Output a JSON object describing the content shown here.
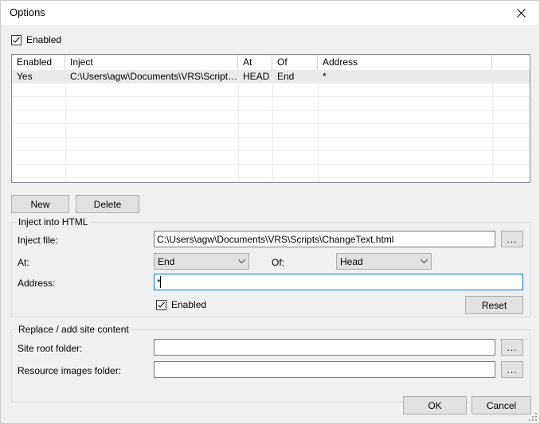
{
  "window": {
    "title": "Options",
    "close_icon": "close-icon"
  },
  "top_enabled": {
    "label": "Enabled",
    "checked": true
  },
  "grid": {
    "columns": [
      {
        "key": "enabled",
        "label": "Enabled"
      },
      {
        "key": "inject",
        "label": "Inject"
      },
      {
        "key": "at",
        "label": "At"
      },
      {
        "key": "of",
        "label": "Of"
      },
      {
        "key": "address",
        "label": "Address"
      }
    ],
    "rows": [
      {
        "enabled": "Yes",
        "inject": "C:\\Users\\agw\\Documents\\VRS\\Scripts...",
        "at": "HEAD",
        "of": "End",
        "address": "*",
        "selected": true
      }
    ]
  },
  "list_buttons": {
    "new_label": "New",
    "delete_label": "Delete"
  },
  "inject_group": {
    "caption": "Inject into HTML",
    "inject_file_label": "Inject file:",
    "inject_file_value": "C:\\Users\\agw\\Documents\\VRS\\Scripts\\ChangeText.html",
    "inject_file_browse_label": "...",
    "at_label": "At:",
    "at_value": "End",
    "of_label": "Of:",
    "of_value": "Head",
    "address_label": "Address:",
    "address_value": "*",
    "enabled_label": "Enabled",
    "enabled_checked": true,
    "reset_label": "Reset"
  },
  "replace_group": {
    "caption": "Replace / add site content",
    "site_root_label": "Site root folder:",
    "site_root_value": "",
    "site_root_browse_label": "...",
    "resource_images_label": "Resource images folder:",
    "resource_images_value": "",
    "resource_images_browse_label": "..."
  },
  "footer": {
    "ok_label": "OK",
    "cancel_label": "Cancel"
  },
  "colors": {
    "dialog_bg": "#f0f0f0",
    "titlebar_bg": "#ffffff",
    "button_face": "#e1e1e1",
    "button_border": "#adadad",
    "input_border": "#7a7a7a",
    "focus_border": "#0078d7",
    "grid_border": "#828790",
    "grid_line": "#ededed",
    "selected_row": "#eaeaea",
    "group_border": "#dcdcdc"
  }
}
